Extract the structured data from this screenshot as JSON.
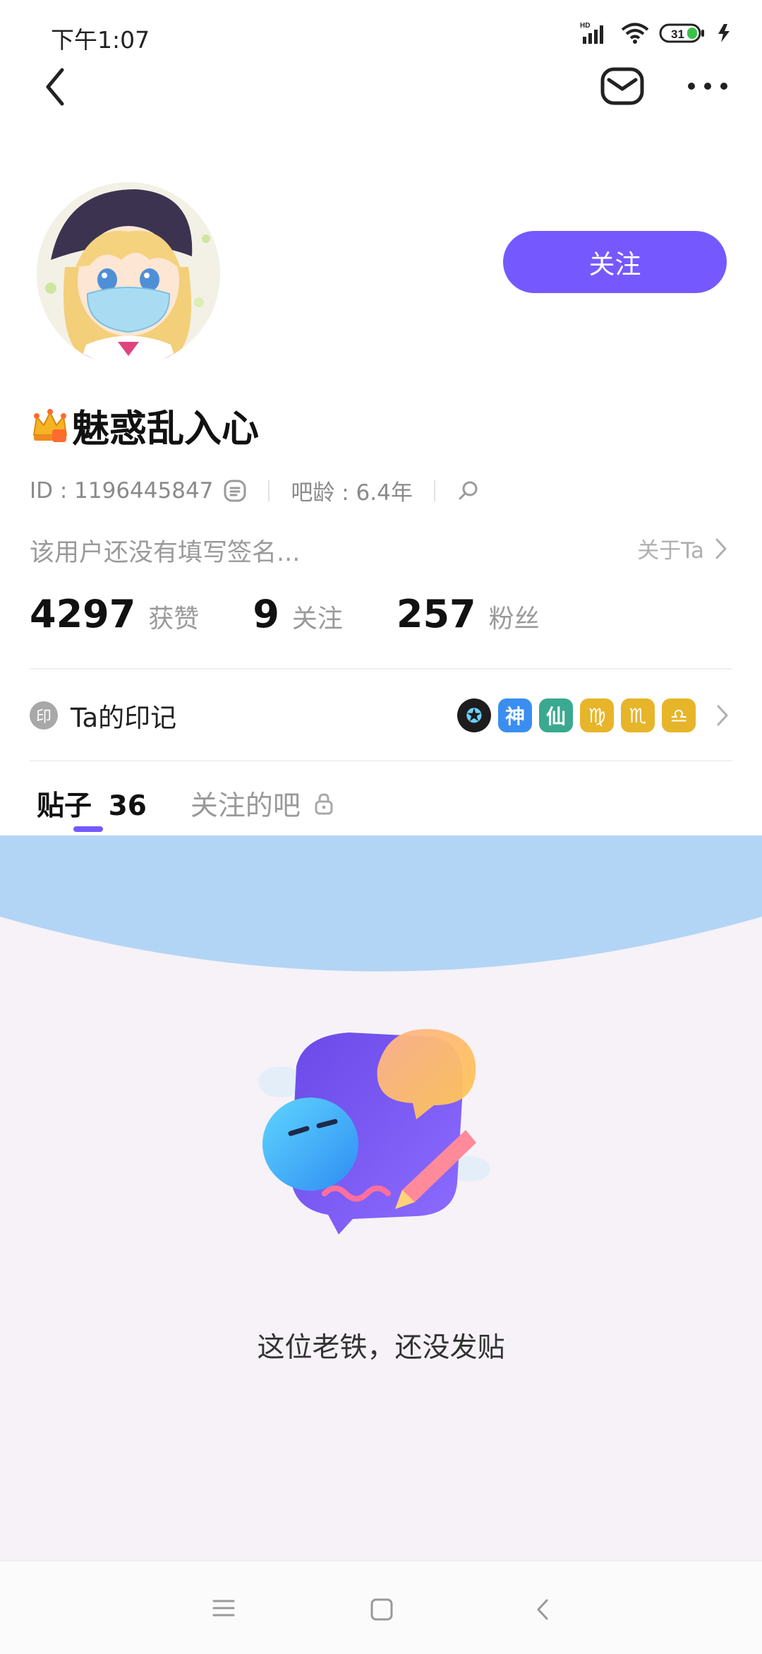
{
  "status": {
    "time": "下午1:07",
    "network": "HD",
    "battery": "31"
  },
  "profile": {
    "username": "魅惑乱入心",
    "follow_label": "关注",
    "id_text": "ID : 1196445847",
    "age_text": "吧龄 : 6.4年",
    "signature": "该用户还没有填写签名...",
    "about_label": "关于Ta"
  },
  "stats": [
    {
      "value": "4297",
      "label": "获赞"
    },
    {
      "value": "9",
      "label": "关注"
    },
    {
      "value": "257",
      "label": "粉丝"
    }
  ],
  "badges": {
    "seal": "印",
    "title": "Ta的印记",
    "items": [
      {
        "glyph": "✪",
        "color": "#1d1d1d"
      },
      {
        "glyph": "神",
        "color": "#3a8ef0"
      },
      {
        "glyph": "仙",
        "color": "#39a98f"
      },
      {
        "glyph": "♍",
        "color": "#e7b52a"
      },
      {
        "glyph": "♏",
        "color": "#e7b52a"
      },
      {
        "glyph": "♎",
        "color": "#e7b52a"
      }
    ]
  },
  "tabs": {
    "posts_label": "贴子",
    "posts_count": "36",
    "followed_bars_label": "关注的吧"
  },
  "empty": {
    "message": "这位老铁，还没发贴"
  },
  "colors": {
    "accent": "#7559ff",
    "empty_bg": "#f6f2f7",
    "wave": "#b3d5f5"
  }
}
